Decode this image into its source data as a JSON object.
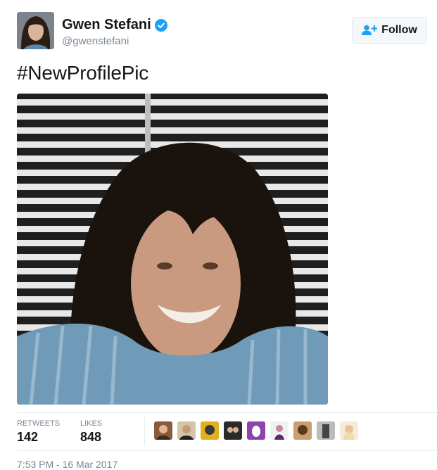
{
  "header": {
    "display_name": "Gwen Stefani",
    "handle": "@gwenstefani",
    "follow_label": "Follow"
  },
  "tweet": {
    "text": "#NewProfilePic"
  },
  "stats": {
    "retweets_label": "RETWEETS",
    "retweets_count": "142",
    "likes_label": "LIKES",
    "likes_count": "848"
  },
  "likers": [
    {
      "icon": "liker-avatar"
    },
    {
      "icon": "liker-avatar"
    },
    {
      "icon": "liker-avatar"
    },
    {
      "icon": "liker-avatar"
    },
    {
      "icon": "default-egg-avatar"
    },
    {
      "icon": "liker-avatar"
    },
    {
      "icon": "liker-avatar"
    },
    {
      "icon": "liker-avatar"
    },
    {
      "icon": "liker-avatar"
    }
  ],
  "footer": {
    "timestamp": "7:53 PM - 16 Mar 2017"
  },
  "colors": {
    "accent": "#1da1f2",
    "text": "#14171a",
    "muted": "#7b8794"
  }
}
